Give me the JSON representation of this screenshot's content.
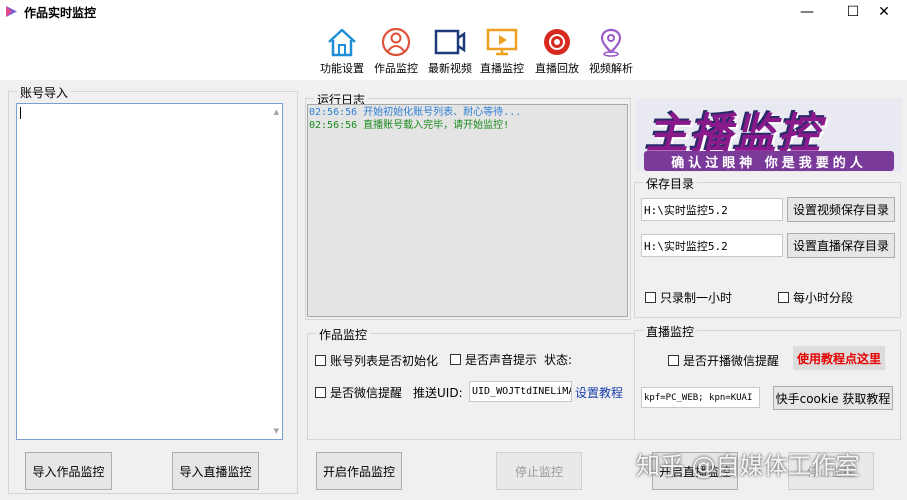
{
  "window": {
    "title": "作品实时监控",
    "minimize": "—",
    "maximize": "☐",
    "close": "✕"
  },
  "toolbar": {
    "items": [
      {
        "label": "功能设置",
        "icon": "home-icon"
      },
      {
        "label": "作品监控",
        "icon": "user-circle-icon"
      },
      {
        "label": "最新视频",
        "icon": "video-camera-icon"
      },
      {
        "label": "直播监控",
        "icon": "monitor-play-icon"
      },
      {
        "label": "直播回放",
        "icon": "record-icon"
      },
      {
        "label": "视频解析",
        "icon": "location-pin-icon"
      }
    ]
  },
  "account_import": {
    "title": "账号导入",
    "import_work_button": "导入作品监控",
    "import_live_button": "导入直播监控"
  },
  "log": {
    "title": "运行日志",
    "lines": [
      {
        "text": "02:56:56 开始初始化账号列表、耐心等待...",
        "color": "#2c7fd6"
      },
      {
        "text": "02:56:56 直播账号载入完毕，请开始监控!",
        "color": "#1b8a1b"
      }
    ]
  },
  "banner": {
    "main_text": "主播监控",
    "sub_text": "确认过眼神 你是我要的人"
  },
  "save_dir": {
    "title": "保存目录",
    "video_path": "H:\\实时监控5.2",
    "live_path": "H:\\实时监控5.2",
    "set_video_button": "设置视频保存目录",
    "set_live_button": "设置直播保存目录",
    "only_one_hour": "只录制一小时",
    "split_hourly": "每小时分段"
  },
  "work_monitor": {
    "title": "作品监控",
    "init_list": "账号列表是否初始化",
    "sound_alert": "是否声音提示",
    "status_label": "状态:",
    "wechat_alert": "是否微信提醒",
    "push_uid_label": "推送UID:",
    "uid_value": "UID_WOJTtdINELiMA",
    "setup_tutorial": "设置教程",
    "start_button": "开启作品监控",
    "stop_button": "停止监控"
  },
  "live_monitor": {
    "title": "直播监控",
    "wechat_alert": "是否开播微信提醒",
    "tutorial_link": "使用教程点这里",
    "cookie_value": "kpf=PC_WEB; kpn=KUAI",
    "cookie_button": "快手cookie 获取教程",
    "start_button": "开启直播监控",
    "stop_button": "停止监控"
  },
  "watermark": "知乎 @自媒体工作室"
}
